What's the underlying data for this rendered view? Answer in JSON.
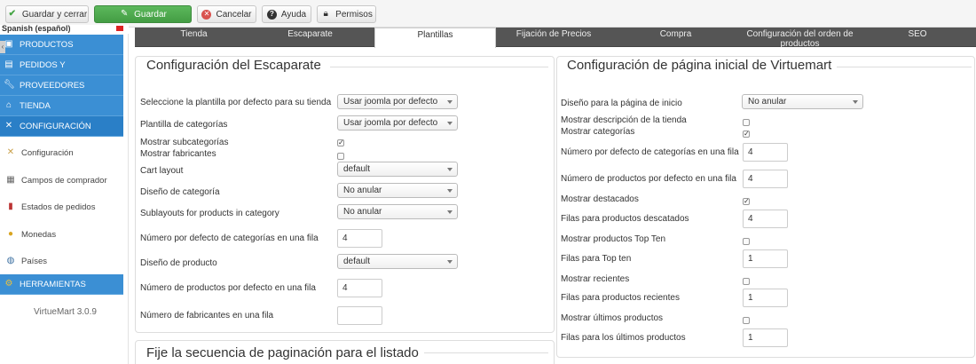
{
  "toolbar": {
    "save_close": "Guardar y cerrar",
    "save": "Guardar",
    "cancel": "Cancelar",
    "help": "Ayuda",
    "permissions": "Permisos"
  },
  "sidebar": {
    "language": "Spanish (español)",
    "sections": [
      {
        "label": "PRODUCTOS",
        "icon": "product-icon"
      },
      {
        "label": "PEDIDOS Y",
        "icon": "orders-icon"
      },
      {
        "label": "PROVEEDORES",
        "icon": "suppliers-icon"
      },
      {
        "label": "TIENDA",
        "icon": "store-icon"
      },
      {
        "label": "CONFIGURACIÓN",
        "icon": "config-icon"
      }
    ],
    "items": [
      {
        "label": "Configuración",
        "icon": "settings-icon"
      },
      {
        "label": "Campos de comprador",
        "icon": "fields-icon"
      },
      {
        "label": "Estados de pedidos",
        "icon": "status-icon"
      },
      {
        "label": "Monedas",
        "icon": "coins-icon"
      },
      {
        "label": "Países",
        "icon": "globe-icon"
      }
    ],
    "tools": "HERRAMIENTAS",
    "version": "VirtueMart 3.0.9"
  },
  "tabs": [
    {
      "label": "Tienda"
    },
    {
      "label": "Escaparate"
    },
    {
      "label": "Plantillas",
      "active": true
    },
    {
      "label": "Fijación de Precios"
    },
    {
      "label": "Compra"
    },
    {
      "label": "Configuración del orden de productos"
    },
    {
      "label": "SEO"
    }
  ],
  "left_panel": {
    "title": "Configuración del Escaparate",
    "default_template_label": "Seleccione la plantilla por defecto para su tienda",
    "default_template_value": "Usar joomla por defecto",
    "category_template_label": "Plantilla de categorías",
    "category_template_value": "Usar joomla por defecto",
    "show_subcategories_label": "Mostrar subcategorías",
    "show_subcategories": true,
    "show_manufacturers_label": "Mostrar fabricantes",
    "show_manufacturers": false,
    "cart_layout_label": "Cart layout",
    "cart_layout_value": "default",
    "category_design_label": "Diseño de categoría",
    "category_design_value": "No anular",
    "sublayouts_label": "Sublayouts for products in category",
    "sublayouts_value": "No anular",
    "categories_per_row_label": "Número por defecto de categorías en una fila",
    "categories_per_row": "4",
    "product_design_label": "Diseño de producto",
    "product_design_value": "default",
    "products_per_row_label": "Número de productos por defecto en una fila",
    "products_per_row": "4",
    "manufacturers_per_row_label": "Número de fabricantes en una fila",
    "manufacturers_per_row": ""
  },
  "pagination_panel": {
    "title": "Fije la secuencia de paginación para el listado"
  },
  "right_panel": {
    "title": "Configuración de página inicial de Virtuemart",
    "home_design_label": "Diseño para la página de inicio",
    "home_design_value": "No anular",
    "show_store_desc_label": "Mostrar descripción de la tienda",
    "show_store_desc": false,
    "show_categories_label": "Mostrar categorías",
    "show_categories": true,
    "categories_per_row_label": "Número por defecto de categorías en una fila",
    "categories_per_row": "4",
    "products_per_row_label": "Número de productos por defecto en una fila",
    "products_per_row": "4",
    "show_featured_label": "Mostrar destacados",
    "show_featured": true,
    "featured_rows_label": "Filas para productos descatados",
    "featured_rows": "4",
    "show_topten_label": "Mostrar productos Top Ten",
    "show_topten": false,
    "topten_rows_label": "Filas para Top ten",
    "topten_rows": "1",
    "show_recent_label": "Mostrar recientes",
    "show_recent": false,
    "recent_rows_label": "Filas para productos recientes",
    "recent_rows": "1",
    "show_latest_label": "Mostrar últimos productos",
    "show_latest": false,
    "latest_rows_label": "Filas para los últimos productos",
    "latest_rows": "1"
  }
}
